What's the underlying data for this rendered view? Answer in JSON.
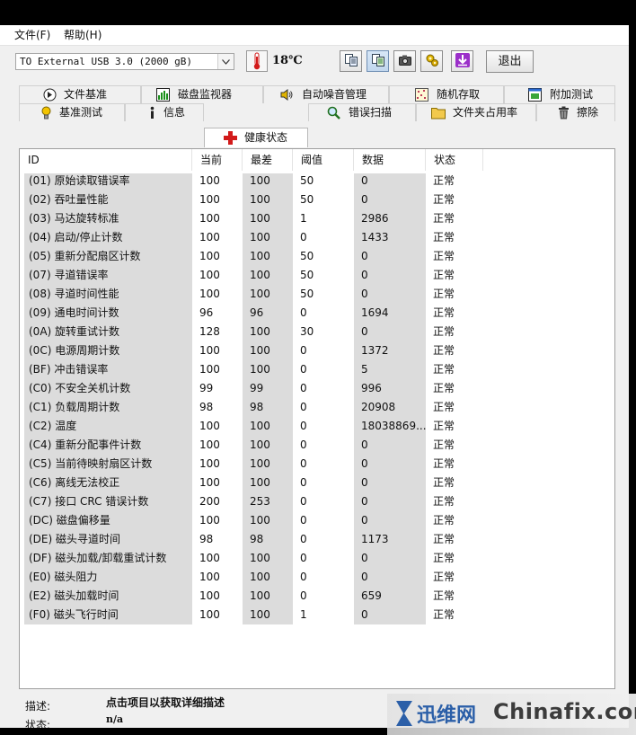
{
  "menu": [
    {
      "label": "文件(F)"
    },
    {
      "label": "帮助(H)"
    }
  ],
  "toolbar": {
    "drive": "TO External USB 3.0 (2000 gB)",
    "temperature": "18℃",
    "exit_label": "退出",
    "buttons": [
      "copy-info-icon",
      "copy-all-icon",
      "screenshot-camera-icon",
      "options-icon",
      "save-arrow-icon"
    ],
    "icon_colors": {
      "thermometer": "#d21a1a",
      "save": "#9b2fc9"
    }
  },
  "tabs": {
    "row1": [
      {
        "label": "文件基准",
        "icon": "file-benchmark-icon"
      },
      {
        "label": "磁盘监视器",
        "icon": "disk-monitor-icon"
      },
      {
        "label": "自动噪音管理",
        "icon": "speaker-icon"
      },
      {
        "label": "随机存取",
        "icon": "random-access-icon"
      },
      {
        "label": "附加测试",
        "icon": "extra-tests-icon"
      }
    ],
    "row2": [
      {
        "label": "基准测试",
        "icon": "benchmark-icon"
      },
      {
        "label": "信息",
        "icon": "info-icon"
      },
      {
        "label": "健康状态",
        "icon": "health-cross-icon"
      },
      {
        "label": "错误扫描",
        "icon": "error-scan-magnifier-icon"
      },
      {
        "label": "文件夹占用率",
        "icon": "folder-usage-icon"
      },
      {
        "label": "擦除",
        "icon": "erase-trash-icon"
      }
    ],
    "active": "健康状态"
  },
  "table": {
    "columns": [
      "ID",
      "当前",
      "最差",
      "阈值",
      "数据",
      "状态"
    ],
    "rows": [
      [
        "(01) 原始读取错误率",
        "100",
        "100",
        "50",
        "0",
        "正常"
      ],
      [
        "(02) 吞吐量性能",
        "100",
        "100",
        "50",
        "0",
        "正常"
      ],
      [
        "(03) 马达旋转标准",
        "100",
        "100",
        "1",
        "2986",
        "正常"
      ],
      [
        "(04) 启动/停止计数",
        "100",
        "100",
        "0",
        "1433",
        "正常"
      ],
      [
        "(05) 重新分配扇区计数",
        "100",
        "100",
        "50",
        "0",
        "正常"
      ],
      [
        "(07) 寻道错误率",
        "100",
        "100",
        "50",
        "0",
        "正常"
      ],
      [
        "(08) 寻道时间性能",
        "100",
        "100",
        "50",
        "0",
        "正常"
      ],
      [
        "(09) 通电时间计数",
        "96",
        "96",
        "0",
        "1694",
        "正常"
      ],
      [
        "(0A) 旋转重试计数",
        "128",
        "100",
        "30",
        "0",
        "正常"
      ],
      [
        "(0C) 电源周期计数",
        "100",
        "100",
        "0",
        "1372",
        "正常"
      ],
      [
        "(BF) 冲击错误率",
        "100",
        "100",
        "0",
        "5",
        "正常"
      ],
      [
        "(C0) 不安全关机计数",
        "99",
        "99",
        "0",
        "996",
        "正常"
      ],
      [
        "(C1) 负载周期计数",
        "98",
        "98",
        "0",
        "20908",
        "正常"
      ],
      [
        "(C2) 温度",
        "100",
        "100",
        "0",
        "18038869...",
        "正常"
      ],
      [
        "(C4) 重新分配事件计数",
        "100",
        "100",
        "0",
        "0",
        "正常"
      ],
      [
        "(C5) 当前待映射扇区计数",
        "100",
        "100",
        "0",
        "0",
        "正常"
      ],
      [
        "(C6) 离线无法校正",
        "100",
        "100",
        "0",
        "0",
        "正常"
      ],
      [
        "(C7) 接口 CRC 错误计数",
        "200",
        "253",
        "0",
        "0",
        "正常"
      ],
      [
        "(DC) 磁盘偏移量",
        "100",
        "100",
        "0",
        "0",
        "正常"
      ],
      [
        "(DE) 磁头寻道时间",
        "98",
        "98",
        "0",
        "1173",
        "正常"
      ],
      [
        "(DF) 磁头加载/卸载重试计数",
        "100",
        "100",
        "0",
        "0",
        "正常"
      ],
      [
        "(E0) 磁头阻力",
        "100",
        "100",
        "0",
        "0",
        "正常"
      ],
      [
        "(E2) 磁头加载时间",
        "100",
        "100",
        "0",
        "659",
        "正常"
      ],
      [
        "(F0) 磁头飞行时间",
        "100",
        "100",
        "1",
        "0",
        "正常"
      ]
    ]
  },
  "footer": {
    "desc_label": "描述:",
    "desc_value": "点击项目以获取详细描述",
    "status_label": "状态:",
    "status_value": "n/a"
  },
  "watermark": {
    "cn": "迅维网",
    "en": "Chinafix.com"
  }
}
